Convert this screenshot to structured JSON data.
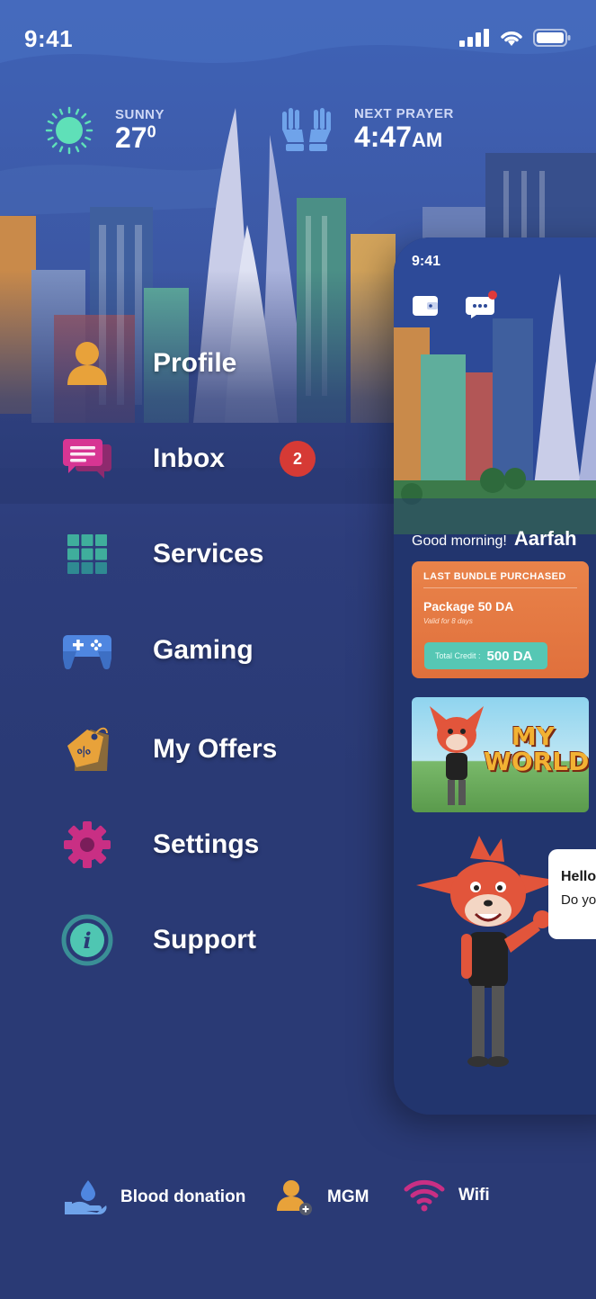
{
  "status_bar": {
    "time": "9:41"
  },
  "weather": {
    "label": "SUNNY",
    "temp": "27",
    "unit": "0"
  },
  "prayer": {
    "label": "NEXT PRAYER",
    "time": "4:47",
    "ampm": "AM"
  },
  "menu": {
    "items": [
      {
        "label": "Profile",
        "icon": "user-icon"
      },
      {
        "label": "Inbox",
        "icon": "chat-icon",
        "badge": "2"
      },
      {
        "label": "Services",
        "icon": "grid-icon"
      },
      {
        "label": "Gaming",
        "icon": "gamepad-icon"
      },
      {
        "label": "My Offers",
        "icon": "tag-icon"
      },
      {
        "label": "Settings",
        "icon": "gear-icon"
      },
      {
        "label": "Support",
        "icon": "info-icon"
      }
    ]
  },
  "preview": {
    "time": "9:41",
    "greeting": "Good morning!",
    "user_name": "Aarfah",
    "bundle": {
      "title": "LAST BUNDLE PURCHASED",
      "package": "Package 50 DA",
      "valid": "Valid for 8 days",
      "credit_label": "Total Credit :",
      "credit_value": "500 DA"
    },
    "banner_title": "MY WORLD",
    "bubble_title": "Hello",
    "bubble_text": "Do you"
  },
  "bottom_bar": {
    "items": [
      {
        "label": "Blood donation",
        "icon": "blood-donation-icon"
      },
      {
        "label": "MGM",
        "icon": "add-user-icon"
      },
      {
        "label": "Wifi",
        "icon": "wifi-icon"
      }
    ]
  },
  "colors": {
    "background": "#2a3a75",
    "badge": "#d63a35",
    "bundle": "#e9834a",
    "credit": "#56c7b4",
    "sun": "#5fe0b8"
  }
}
